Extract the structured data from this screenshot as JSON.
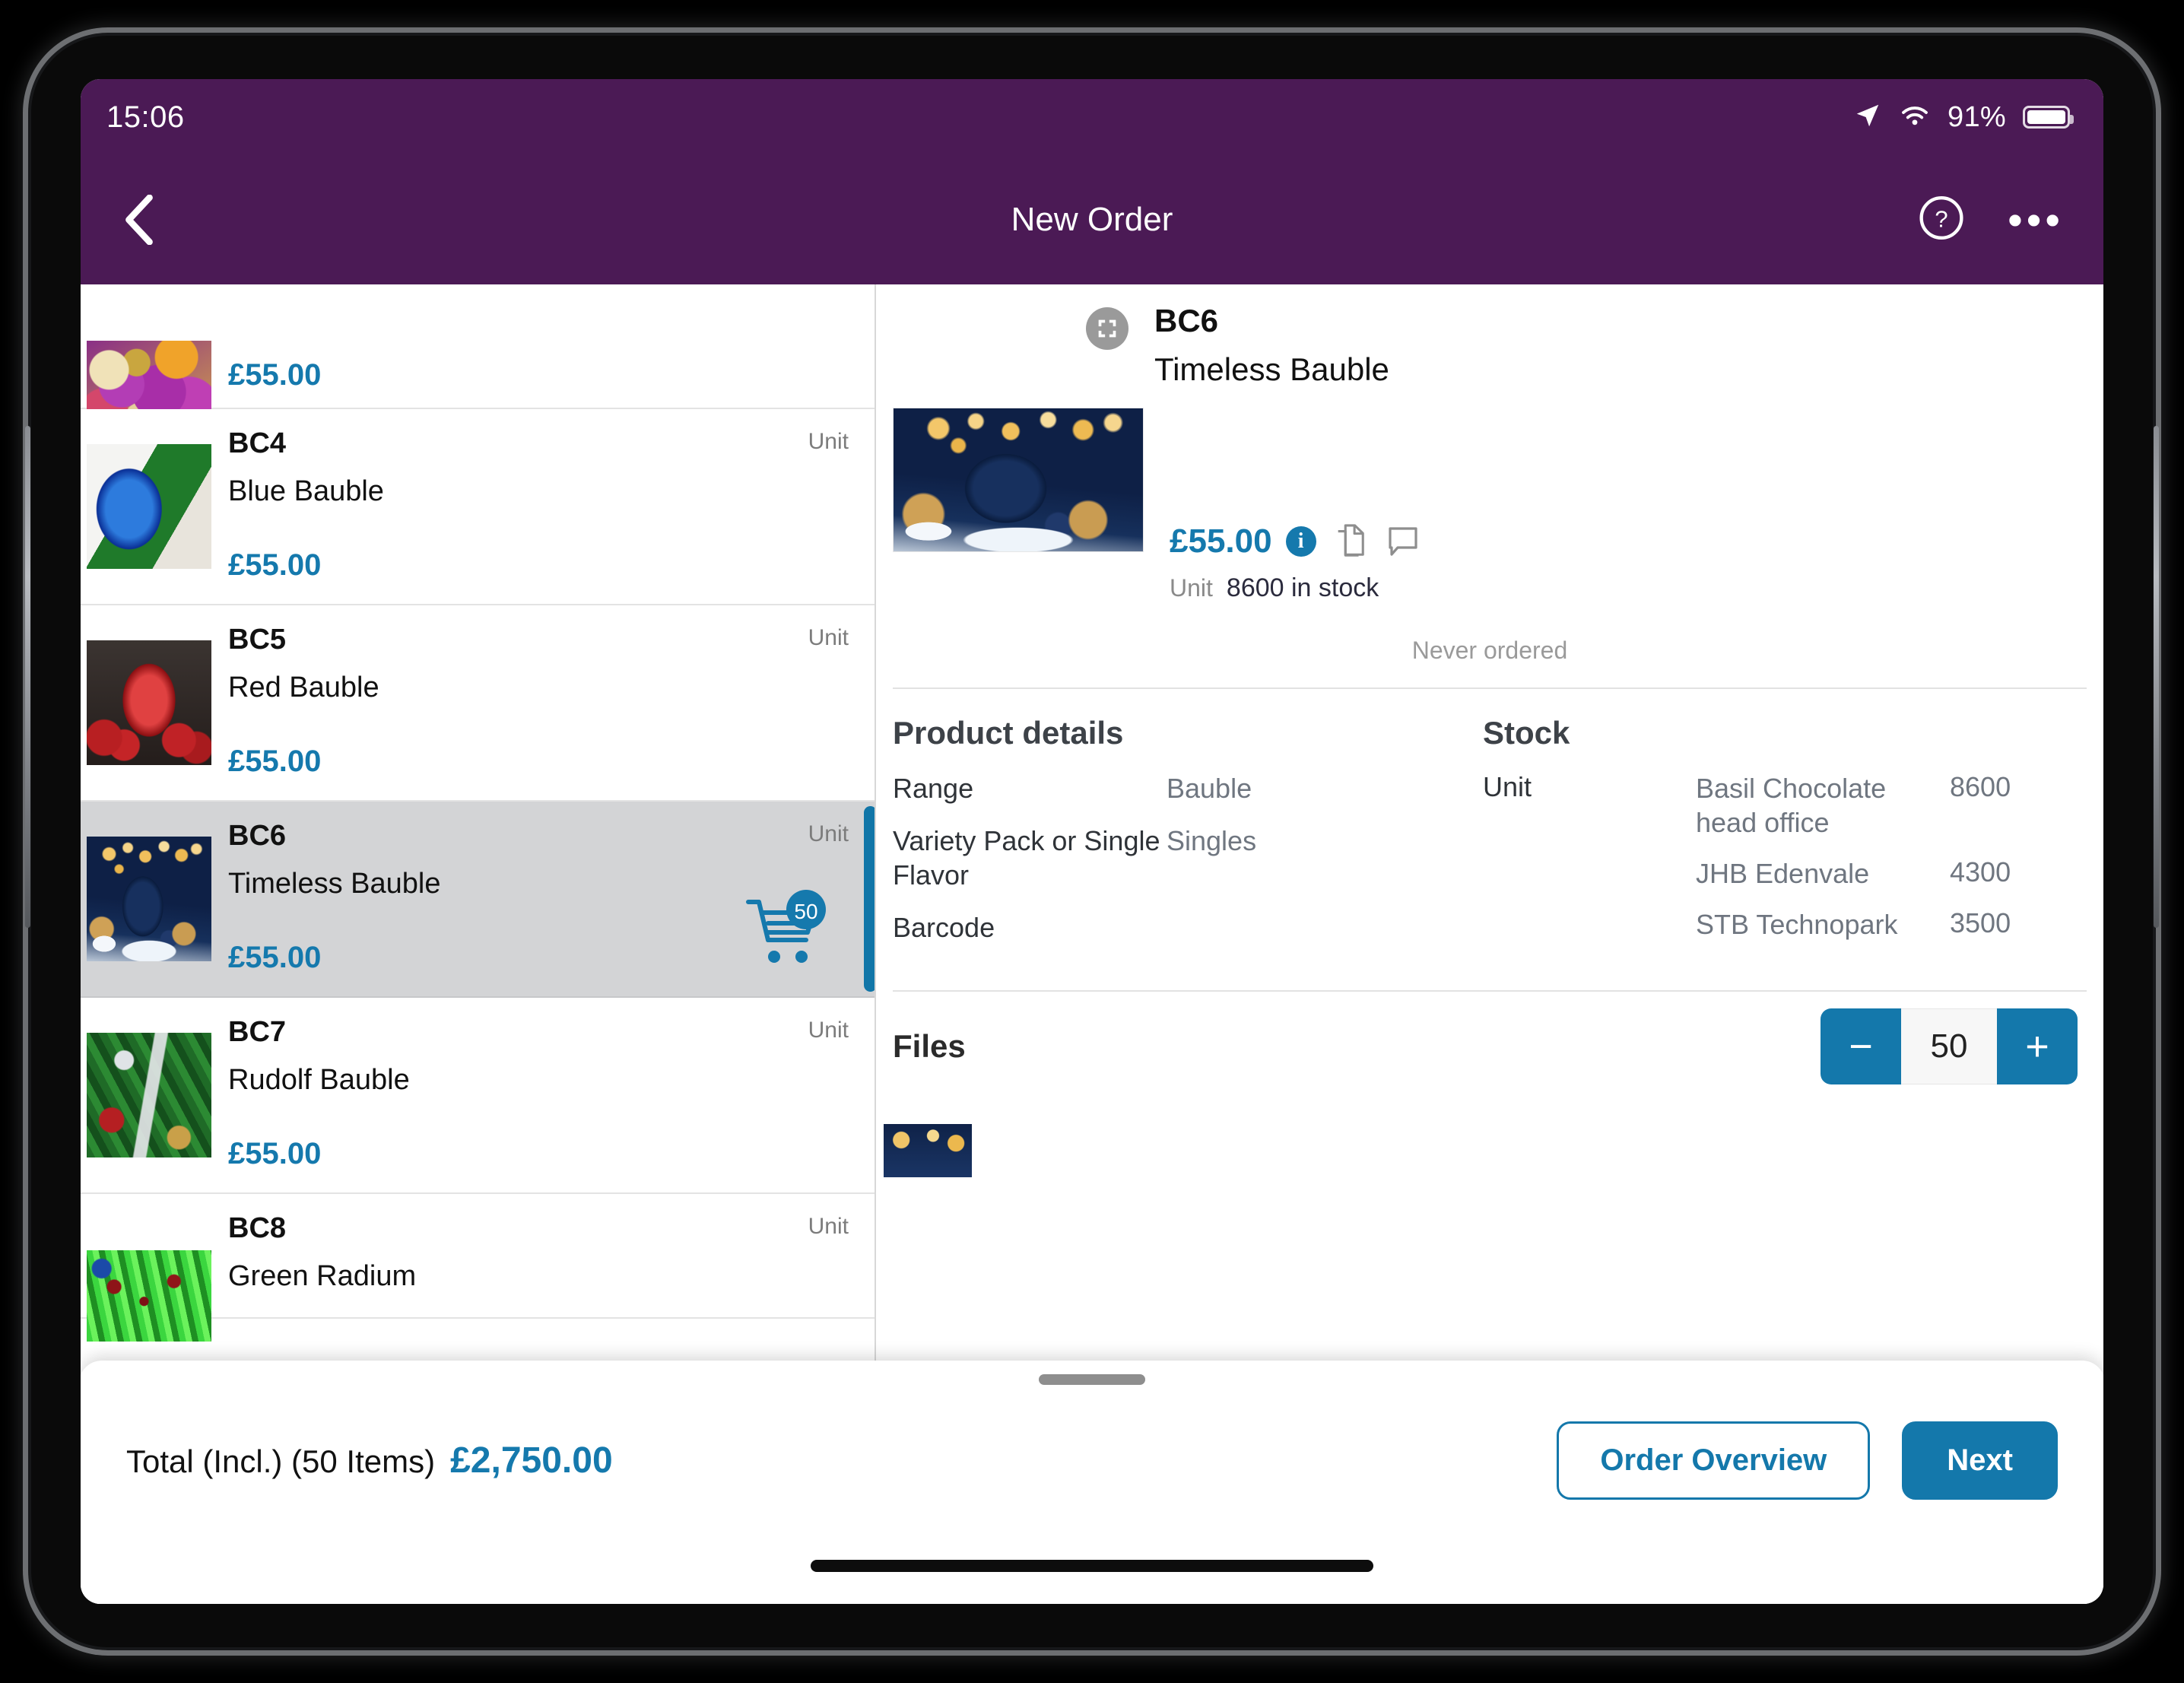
{
  "theme": {
    "nav_purple": "#4b1a55",
    "accent_blue": "#1478ab",
    "price_blue": "#1579ad",
    "selected_row_bg": "#d3d4d6"
  },
  "statusbar": {
    "time": "15:06",
    "battery_percent": "91%",
    "icons": [
      "location-arrow-icon",
      "wifi-icon",
      "battery-icon"
    ]
  },
  "navbar": {
    "back_label": "‹",
    "title": "New Order",
    "help_label": "?",
    "more_label": "•••"
  },
  "product_list": {
    "items": [
      {
        "sku": "",
        "name": "",
        "price": "£55.00",
        "unit": "",
        "thumb": "baubles-purple",
        "partial": true,
        "selected": false,
        "cart_qty": ""
      },
      {
        "sku": "BC4",
        "name": "Blue Bauble",
        "price": "£55.00",
        "unit": "Unit",
        "thumb": "blue-bauble",
        "partial": false,
        "selected": false,
        "cart_qty": ""
      },
      {
        "sku": "BC5",
        "name": "Red Bauble",
        "price": "£55.00",
        "unit": "Unit",
        "thumb": "red-bauble",
        "partial": false,
        "selected": false,
        "cart_qty": ""
      },
      {
        "sku": "BC6",
        "name": "Timeless Bauble",
        "price": "£55.00",
        "unit": "Unit",
        "thumb": "timeless",
        "partial": false,
        "selected": true,
        "cart_qty": "50"
      },
      {
        "sku": "BC7",
        "name": "Rudolf Bauble",
        "price": "£55.00",
        "unit": "Unit",
        "thumb": "rudolf",
        "partial": false,
        "selected": false,
        "cart_qty": ""
      },
      {
        "sku": "BC8",
        "name": "Green Radium",
        "price": "",
        "unit": "Unit",
        "thumb": "green-radium",
        "partial": true,
        "selected": false,
        "cart_qty": ""
      }
    ]
  },
  "detail": {
    "sku": "BC6",
    "name": "Timeless Bauble",
    "header_icon": "scan-expand-icon",
    "hero_image": "timeless-bauble-photo",
    "price": "£55.00",
    "info_icon_label": "i",
    "action_icons": [
      "documents-icon",
      "comment-icon"
    ],
    "unit_label": "Unit",
    "stock_summary": "8600 in stock",
    "order_history": "Never ordered",
    "product_details": {
      "title": "Product details",
      "rows": [
        {
          "label": "Range",
          "value": "Bauble"
        },
        {
          "label": "Variety Pack or Single Flavor",
          "value": "Singles"
        },
        {
          "label": "Barcode",
          "value": ""
        }
      ]
    },
    "stock": {
      "title": "Stock",
      "unit_label": "Unit",
      "locations": [
        {
          "name": "Basil Chocolate head office",
          "qty": "8600"
        },
        {
          "name": "JHB Edenvale",
          "qty": "4300"
        },
        {
          "name": "STB Technopark",
          "qty": "3500"
        }
      ]
    },
    "files": {
      "title": "Files",
      "thumb": "file-thumb"
    },
    "quantity": {
      "minus_label": "−",
      "value": "50",
      "plus_label": "+"
    }
  },
  "bottom_bar": {
    "total_label": "Total (Incl.) (50 Items)",
    "total_amount": "£2,750.00",
    "order_overview_label": "Order Overview",
    "next_label": "Next"
  }
}
